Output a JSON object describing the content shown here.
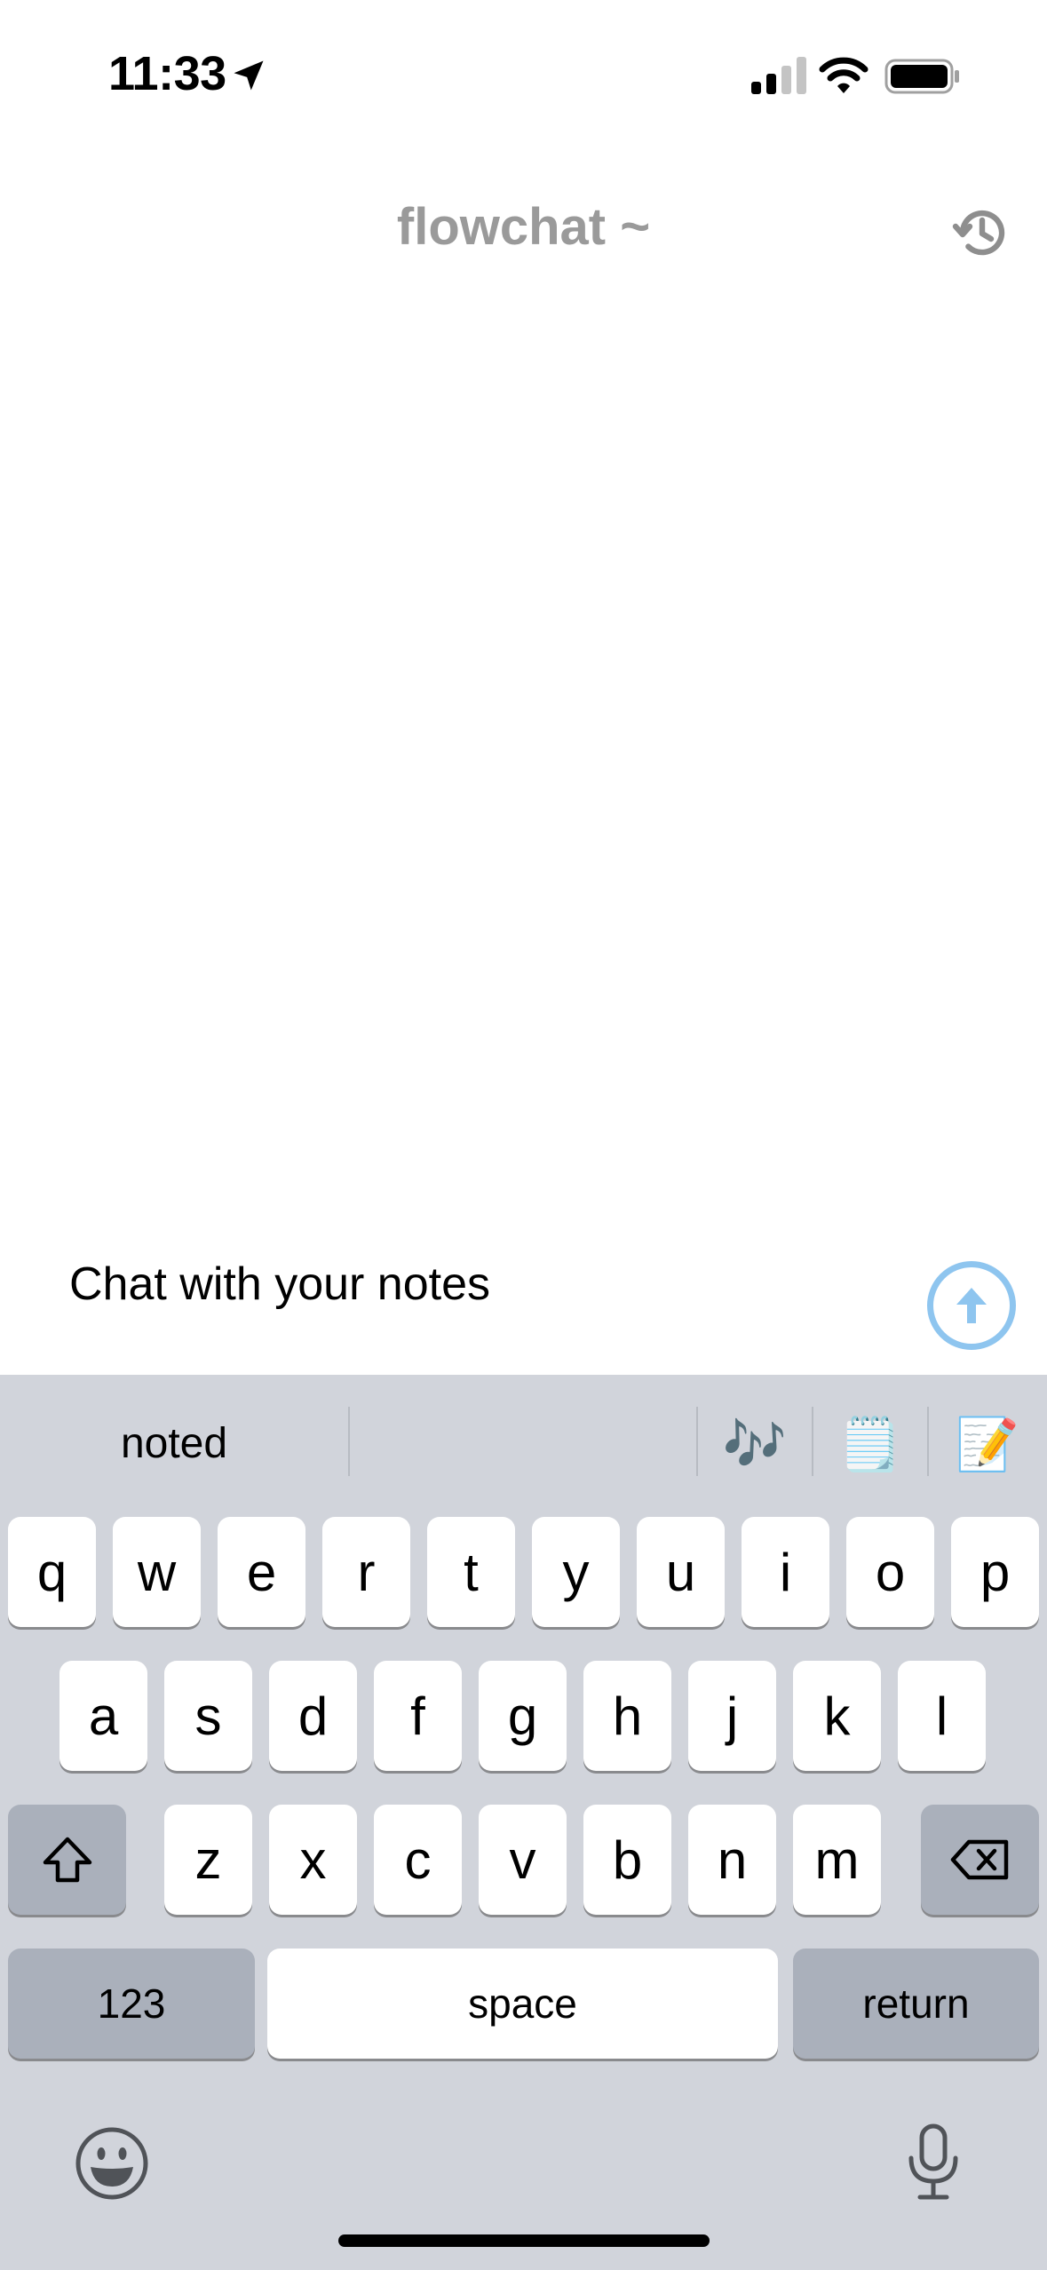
{
  "status_bar": {
    "time": "11:33",
    "icons": [
      "location-arrow-icon",
      "cellular-signal-icon",
      "wifi-icon",
      "battery-icon"
    ]
  },
  "header": {
    "title": "flowchat ~",
    "history_icon": "history-clock-icon"
  },
  "composer": {
    "placeholder": "Chat with your notes",
    "value": "",
    "send_icon": "arrow-up-icon",
    "accent_color": "#8ec5ef"
  },
  "keyboard": {
    "suggestions": {
      "word": "noted",
      "emojis": [
        "🎶",
        "🗒️",
        "📝"
      ]
    },
    "rows": [
      [
        "q",
        "w",
        "e",
        "r",
        "t",
        "y",
        "u",
        "i",
        "o",
        "p"
      ],
      [
        "a",
        "s",
        "d",
        "f",
        "g",
        "h",
        "j",
        "k",
        "l"
      ],
      [
        "z",
        "x",
        "c",
        "v",
        "b",
        "n",
        "m"
      ]
    ],
    "numbers_label": "123",
    "space_label": "space",
    "return_label": "return",
    "shift_icon": "shift-icon",
    "delete_icon": "delete-backspace-icon",
    "emoji_icon": "emoji-face-icon",
    "dictation_icon": "microphone-icon"
  }
}
